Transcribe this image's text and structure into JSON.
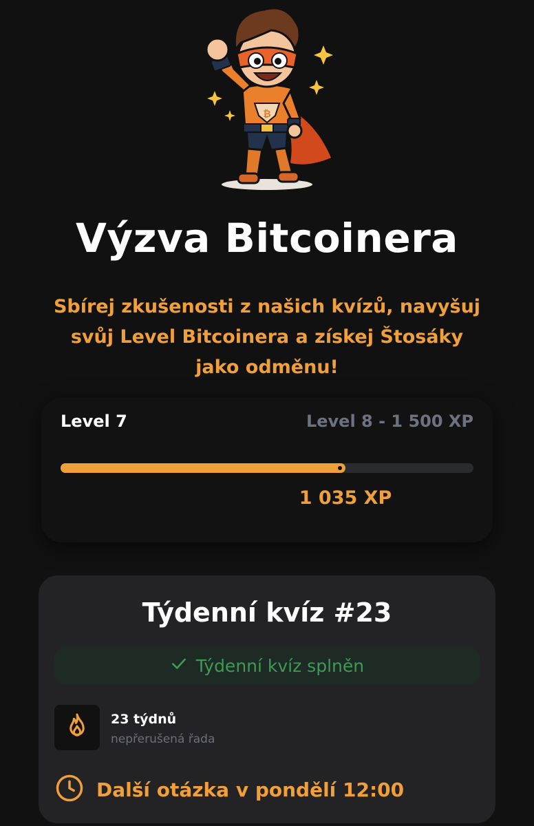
{
  "hero": {
    "mascot": "bitcoin-superhero-mascot"
  },
  "header": {
    "title": "Výzva Bitcoinera",
    "subtitle": "Sbírej zkušenosti z našich kvízů, navyšuj svůj Level Bitcoinera a získej Štosáky jako odměnu!"
  },
  "level": {
    "current": "Level 7",
    "next": "Level 8 - 1 500 XP",
    "xp": "1 035 XP",
    "progress_fraction": 0.69
  },
  "quiz": {
    "title": "Týdenní kvíz #23",
    "status": "Týdenní kvíz splněn",
    "streak_count": "23 týdnů",
    "streak_label": "nepřerušená řada",
    "next_question": "Další otázka v pondělí 12:00"
  },
  "colors": {
    "accent": "#f0a03a",
    "success": "#3e9a55",
    "background": "#111111",
    "card": "#232325"
  },
  "icons": {
    "check": "check-icon",
    "flame": "flame-icon",
    "clock": "clock-icon"
  }
}
